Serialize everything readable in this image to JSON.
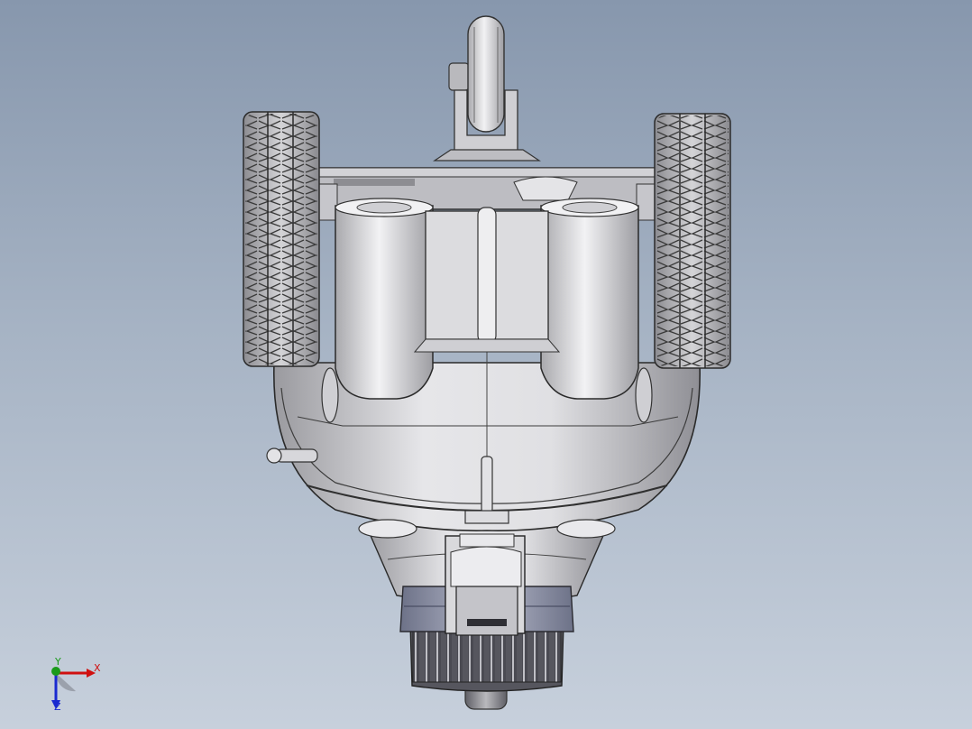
{
  "view": {
    "background_top": "#8797ad",
    "background_bottom": "#c7d0dc",
    "model_color": "#d6d6d9",
    "edge_color": "#2a2a2a",
    "model_name": "",
    "icons": [
      "coordinate-triad-icon"
    ]
  },
  "triad": {
    "x_label": "X",
    "y_label": "Y",
    "z_label": "Z",
    "x_color": "#d01010",
    "y_color": "#1a9a1a",
    "z_color": "#1a2ad0"
  }
}
